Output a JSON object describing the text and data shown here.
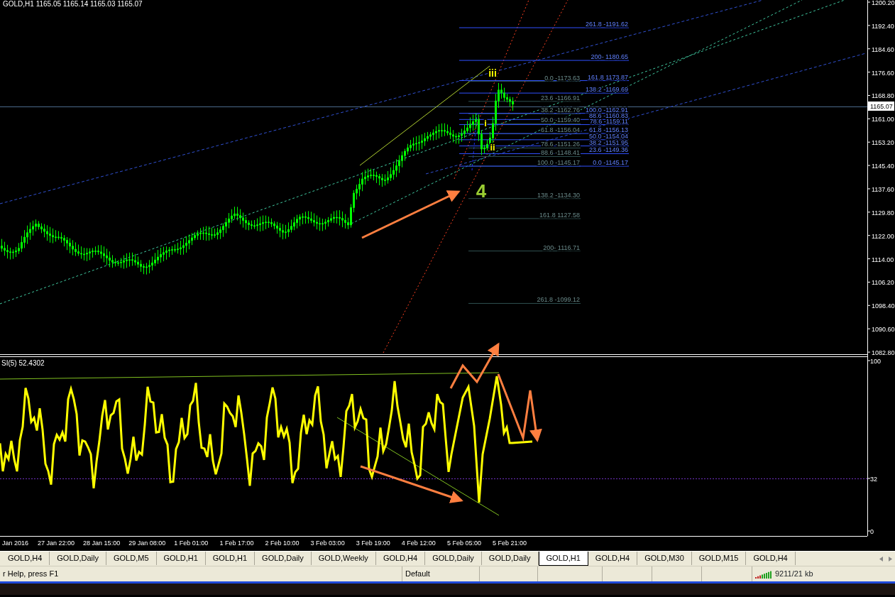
{
  "chart": {
    "title": "GOLD,H1 1165.05 1165.14 1165.03 1165.07",
    "price_axis": [
      "1200.20",
      "1192.40",
      "1184.60",
      "1176.60",
      "1168.80",
      "1161.00",
      "1153.20",
      "1145.40",
      "1137.60",
      "1129.80",
      "1122.00",
      "1114.00",
      "1106.20",
      "1098.40",
      "1090.60",
      "1082.80"
    ],
    "current_price": "1165.07",
    "fib_retracement": [
      "0.0 -1173.63",
      "23.6 -1166.91",
      "38.2 -1162.76",
      "50.0 -1159.40",
      "61.8 -1156.04",
      "78.6 -1151.26",
      "88.6 -1148.41",
      "100.0 -1145.17",
      "138.2  -1134.30",
      "161.8 1127.58",
      "200- 1116.71",
      "261.8 -1099.12"
    ],
    "fib_extension": [
      "261.8 -1191.62",
      "200- 1180.65",
      "161.8 1173.87",
      "138.2  -1169.69",
      "100.0 -1162.91",
      "88.6 -1160.83",
      "78.6 -1159.11",
      "61.8 -1156.13",
      "50.0 -1154.04",
      "38.2 -1151.95",
      "23.6 -1149.36",
      "0.0 -1145.17"
    ],
    "wave_labels": [
      {
        "text": "iii",
        "color": "#ffff00"
      },
      {
        "text": "i",
        "color": "#ffff00"
      },
      {
        "text": "ii",
        "color": "#ffff00"
      },
      {
        "text": "4",
        "color": "#9acd32"
      }
    ]
  },
  "indicator": {
    "title": "SI(5) 52.4302",
    "scale": [
      "100",
      "32",
      "0"
    ]
  },
  "time_axis": [
    "Jan 2016",
    "27 Jan 22:00",
    "28 Jan 15:00",
    "29 Jan 08:00",
    "1 Feb 01:00",
    "1 Feb 17:00",
    "2 Feb 10:00",
    "3 Feb 03:00",
    "3 Feb 19:00",
    "4 Feb 12:00",
    "5 Feb 05:00",
    "5 Feb 21:00"
  ],
  "tabs": [
    {
      "label": "GOLD,H4",
      "selected": false
    },
    {
      "label": "GOLD,Daily",
      "selected": false
    },
    {
      "label": "GOLD,M5",
      "selected": false
    },
    {
      "label": "GOLD,H1",
      "selected": false
    },
    {
      "label": "GOLD,H1",
      "selected": false
    },
    {
      "label": "GOLD,Daily",
      "selected": false
    },
    {
      "label": "GOLD,Weekly",
      "selected": false
    },
    {
      "label": "GOLD,H4",
      "selected": false
    },
    {
      "label": "GOLD,Daily",
      "selected": false
    },
    {
      "label": "GOLD,Daily",
      "selected": false
    },
    {
      "label": "GOLD,H1",
      "selected": true
    },
    {
      "label": "GOLD,H4",
      "selected": false
    },
    {
      "label": "GOLD,M30",
      "selected": false
    },
    {
      "label": "GOLD,M15",
      "selected": false
    },
    {
      "label": "GOLD,H4",
      "selected": false
    }
  ],
  "status_bar": {
    "help": "r Help, press F1",
    "profile": "Default",
    "traffic": "9211/21 kb"
  }
}
